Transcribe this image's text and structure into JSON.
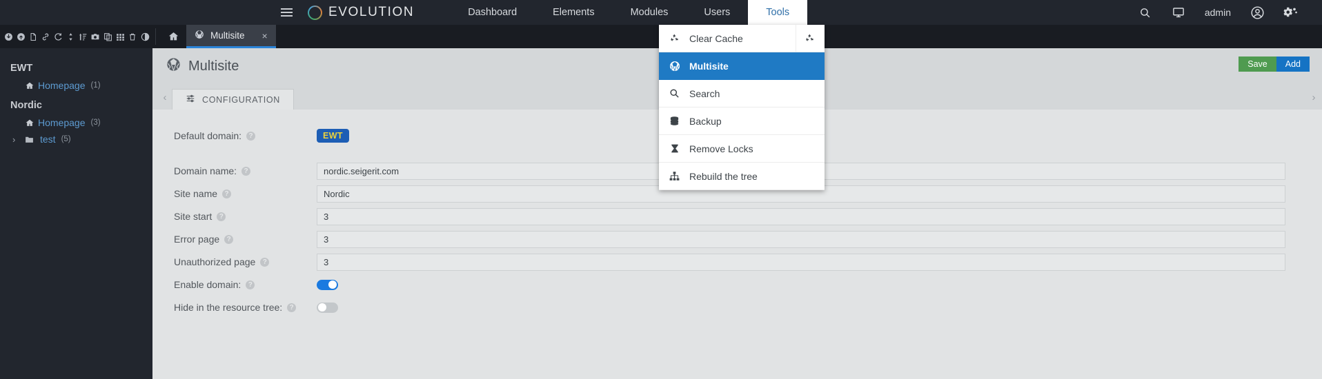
{
  "topbar": {
    "brand": "EVOLUTION",
    "menu_icon": "hamburger-icon",
    "navlinks": [
      {
        "label": "Dashboard",
        "active": false
      },
      {
        "label": "Elements",
        "active": false
      },
      {
        "label": "Modules",
        "active": false
      },
      {
        "label": "Users",
        "active": false
      },
      {
        "label": "Tools",
        "active": true
      }
    ],
    "right": {
      "search_icon": "search-icon",
      "preview_icon": "monitor-icon",
      "user_label": "admin",
      "account_icon": "user-circle-icon",
      "settings_icon": "gears-icon"
    }
  },
  "toolbar": {
    "icons": [
      "download-circle-icon",
      "upload-circle-icon",
      "document-icon",
      "link-icon",
      "refresh-icon",
      "updown-arrows-icon",
      "sort-icon",
      "camera-icon",
      "duplicate-icon",
      "grid-icon",
      "trash-icon",
      "contrast-icon"
    ],
    "home_icon": "home-icon",
    "tab": {
      "label": "Multisite",
      "icon": "multisite-globe-icon",
      "close": "×"
    }
  },
  "tools_menu": {
    "items": [
      {
        "label": "Clear Cache",
        "icon": "recycle-icon",
        "selected": false,
        "trailing_icon": "recycle-icon"
      },
      {
        "label": "Multisite",
        "icon": "multisite-globe-icon",
        "selected": true,
        "trailing_icon": ""
      },
      {
        "label": "Search",
        "icon": "search-icon",
        "selected": false,
        "trailing_icon": ""
      },
      {
        "label": "Backup",
        "icon": "database-icon",
        "selected": false,
        "trailing_icon": ""
      },
      {
        "label": "Remove Locks",
        "icon": "hourglass-icon",
        "selected": false,
        "trailing_icon": ""
      },
      {
        "label": "Rebuild the tree",
        "icon": "sitemap-icon",
        "selected": false,
        "trailing_icon": ""
      }
    ]
  },
  "sidebar": {
    "groups": [
      {
        "title": "EWT",
        "items": [
          {
            "label": "Homepage",
            "count": "(1)",
            "icon": "home-icon",
            "expandable": false
          }
        ]
      },
      {
        "title": "Nordic",
        "items": [
          {
            "label": "Homepage",
            "count": "(3)",
            "icon": "home-icon",
            "expandable": false
          },
          {
            "label": "test",
            "count": "(5)",
            "icon": "folder-icon",
            "expandable": true,
            "chevron": "›"
          }
        ]
      }
    ]
  },
  "main": {
    "title": "Multisite",
    "title_icon": "multisite-globe-icon",
    "save_label": "Save",
    "add_label": "Add",
    "tab_prev": "‹",
    "tab_next": "›",
    "tabs": [
      {
        "label": "CONFIGURATION",
        "icon": "sliders-icon",
        "active": true
      }
    ],
    "fields": [
      {
        "label": "Default domain:",
        "help": "?",
        "type": "badge",
        "value": "EWT"
      },
      {
        "label": "Domain name:",
        "help": "?",
        "type": "text",
        "value": "nordic.seigerit.com"
      },
      {
        "label": "Site name",
        "help": "?",
        "type": "text",
        "value": "Nordic"
      },
      {
        "label": "Site start",
        "help": "?",
        "type": "text",
        "value": "3"
      },
      {
        "label": "Error page",
        "help": "?",
        "type": "text",
        "value": "3"
      },
      {
        "label": "Unauthorized page",
        "help": "?",
        "type": "text",
        "value": "3"
      },
      {
        "label": "Enable domain:",
        "help": "?",
        "type": "toggle",
        "value": "on"
      },
      {
        "label": "Hide in the resource tree:",
        "help": "?",
        "type": "toggle",
        "value": "off"
      }
    ]
  },
  "colors": {
    "accent_blue": "#1f7ac4",
    "save_green": "#4f9b50",
    "badge_blue": "#1d5eb5",
    "badge_text": "#ecd23c",
    "dark_nav": "#22262e"
  }
}
